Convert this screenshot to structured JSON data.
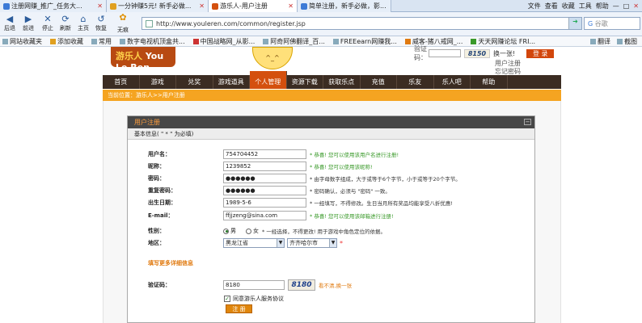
{
  "browser": {
    "tabs": [
      {
        "label": "注册网赚_推广_任务大...",
        "active": false
      },
      {
        "label": "一分钟赚5元! 新手必做...",
        "active": false
      },
      {
        "label": "游乐人-用户注册",
        "active": true
      },
      {
        "label": "简单注册，新手必做，影...",
        "active": false
      }
    ],
    "menu": [
      "文件",
      "查看",
      "收藏",
      "工具",
      "帮助"
    ],
    "nav_buttons": [
      {
        "glyph": "◀",
        "label": "后退"
      },
      {
        "glyph": "▶",
        "label": "前进"
      },
      {
        "glyph": "✕",
        "label": "停止"
      },
      {
        "glyph": "⟳",
        "label": "刷新"
      },
      {
        "glyph": "⌂",
        "label": "主页"
      },
      {
        "glyph": "↺",
        "label": "恢复"
      },
      {
        "glyph": "✿",
        "label": "无痕"
      }
    ],
    "address": "http://www.youleren.com/common/register.jsp",
    "search_placeholder": "谷歌",
    "favorites_left": [
      "网站收藏夹",
      "添加收藏"
    ],
    "favorites": [
      "常用",
      "数字电视机顶盒共...",
      "中国战略网_从影...",
      "阿奇阿佛翻译_百...",
      "FREEearn网赚我...",
      "威客-猪八戒网_...",
      "天天网赚论坛 FRI..."
    ],
    "favorites_right": [
      "翻译",
      "截图"
    ]
  },
  "site": {
    "logo_text": "游乐人",
    "logo_sub": "You Le Ren",
    "mascot_text": "^_^",
    "login": {
      "captcha_label": "验证码：",
      "captcha_value": "8150",
      "change_label": "换一张!",
      "login_btn": "登 录",
      "register_link": "用户注册",
      "forgot_link": "忘记密码"
    },
    "nav": [
      "首页",
      "游戏",
      "兑奖",
      "游戏道具",
      "个人管理",
      "资源下载",
      "获取乐点",
      "充值",
      "乐友",
      "乐人吧",
      "帮助"
    ],
    "nav_active_index": 4,
    "breadcrumb": "当前位置：游乐人>>用户注册"
  },
  "form": {
    "panel_title": "用户注册",
    "section_title": "基本信息( \" * \" 为必填)",
    "fields": [
      {
        "label": "用户名：",
        "value": "754704452",
        "hint": "* 恭喜! 您可以使用该用户名进行注册!",
        "hint_type": "ok"
      },
      {
        "label": "昵称：",
        "value": "1239852",
        "hint": "* 恭喜! 您可以使用该昵称!",
        "hint_type": "ok"
      },
      {
        "label": "密码：",
        "value": "●●●●●●",
        "hint": "* 由字母数字组成，大于或等于6个字节，小于或等于20个字节。",
        "hint_type": "info"
      },
      {
        "label": "重复密码：",
        "value": "●●●●●●",
        "hint": "* 密码确认，必须与 \"密码\" 一致。",
        "hint_type": "info"
      },
      {
        "label": "出生日期：",
        "value": "1989-5-6",
        "hint": "* 一经填写，不得修改。生日当月所有奖品均能享受八折优惠!",
        "hint_type": "info"
      },
      {
        "label": "E-mail：",
        "value": "ffjjzeng@sina.com",
        "hint": "* 恭喜! 您可以使用该邮箱进行注册!",
        "hint_type": "ok"
      }
    ],
    "gender": {
      "label": "性别：",
      "male": "男",
      "female": "女",
      "selected": "男",
      "hint": "* 一经选择，不得更改! 用于游戏中角色定位的依据。"
    },
    "region": {
      "label": "地区：",
      "province": "黑龙江省",
      "city": "齐齐哈尔市",
      "star": "*"
    },
    "more_info": "填写更多详细信息",
    "captcha": {
      "label": "验证码：",
      "value": "8180",
      "image_text": "8180",
      "refresh": "看不清,换一张"
    },
    "agree_label": "同意游乐人服务协议",
    "agree_checked": true,
    "submit": "注 册"
  }
}
